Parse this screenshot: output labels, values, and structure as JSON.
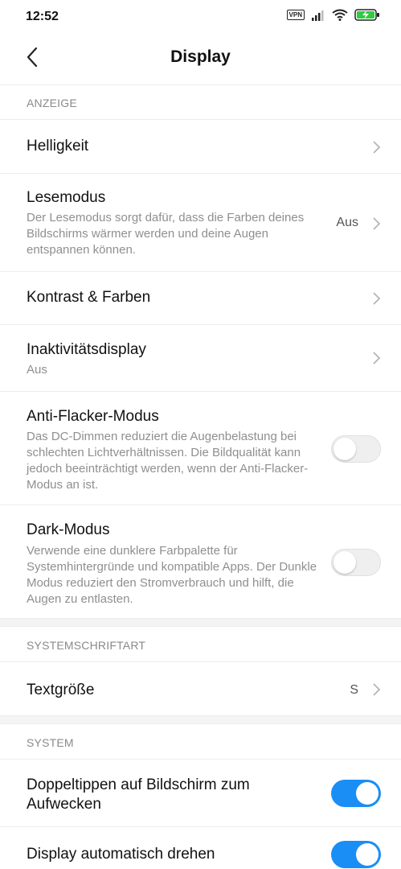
{
  "status_bar": {
    "time": "12:52",
    "vpn_label": "VPN",
    "icons": [
      "vpn-icon",
      "signal-icon",
      "wifi-icon",
      "battery-charging-icon"
    ],
    "battery_color": "#2ecc40"
  },
  "header": {
    "title": "Display",
    "back_icon": "chevron-left-icon"
  },
  "sections": {
    "anzeige": "ANZEIGE",
    "systemschriftart": "SYSTEMSCHRIFTART",
    "system": "SYSTEM"
  },
  "items": {
    "helligkeit": {
      "title": "Helligkeit"
    },
    "lesemodus": {
      "title": "Lesemodus",
      "desc": "Der Lesemodus sorgt dafür, dass die Farben deines Bildschirms wärmer werden und deine Augen entspannen können.",
      "value": "Aus"
    },
    "kontrast": {
      "title": "Kontrast & Farben"
    },
    "inaktivitaet": {
      "title": "Inaktivitätsdisplay",
      "sub": "Aus"
    },
    "antiflacker": {
      "title": "Anti-Flacker-Modus",
      "desc": "Das DC-Dimmen reduziert die Augenbelastung bei schlechten Lichtverhältnissen. Die Bildqualität kann jedoch beeinträchtigt werden, wenn der Anti-Flacker-Modus an ist.",
      "enabled": false
    },
    "darkmodus": {
      "title": "Dark-Modus",
      "desc": "Verwende eine dunklere Farbpalette für Systemhintergründe und kompatible Apps. Der Dunkle Modus reduziert den Stromverbrauch und hilft, die Augen zu entlasten.",
      "enabled": false
    },
    "textgroesse": {
      "title": "Textgröße",
      "value": "S"
    },
    "doppeltippen": {
      "title": "Doppeltippen auf Bildschirm zum Aufwecken",
      "enabled": true
    },
    "autodrehen": {
      "title": "Display automatisch drehen",
      "enabled": true
    }
  },
  "colors": {
    "accent": "#1a8ef5",
    "toggle_off": "#efefef",
    "secondary_text": "#8f8f8f"
  }
}
